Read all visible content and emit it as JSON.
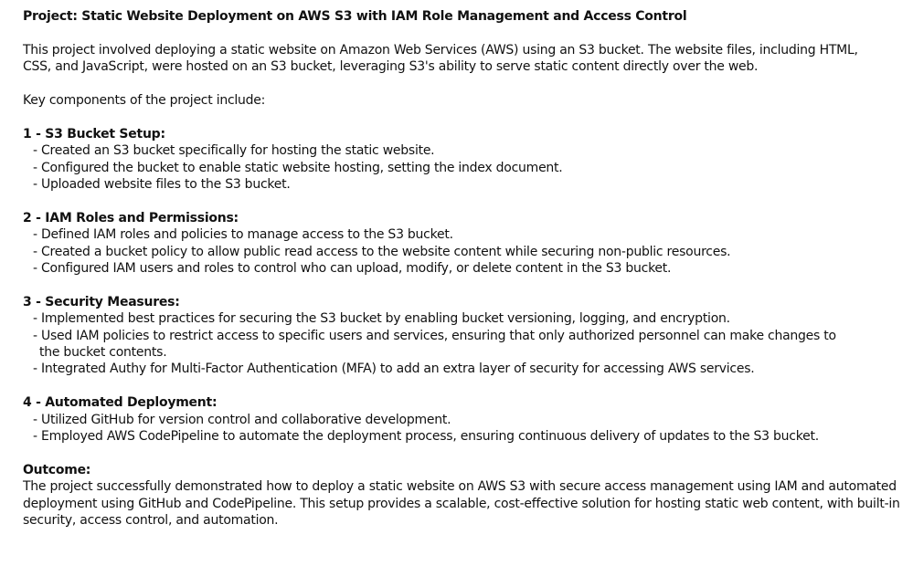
{
  "title": "Project: Static Website Deployment on AWS S3 with IAM Role Management and Access Control",
  "intro": [
    "This project involved deploying a static website on Amazon Web Services (AWS) using an S3 bucket. The website files, including HTML,",
    "CSS, and JavaScript, were hosted on an S3 bucket, leveraging S3's ability to serve static content directly over the web."
  ],
  "key_components_label": "Key components of the project include:",
  "sections": [
    {
      "heading": "1 - S3 Bucket Setup:",
      "items": [
        "- Created an S3 bucket specifically for hosting the static website.",
        "- Configured the bucket to enable static website hosting, setting the index document.",
        "- Uploaded website files to the S3 bucket."
      ]
    },
    {
      "heading": "2 - IAM Roles and Permissions:",
      "items": [
        "- Defined IAM roles and policies to manage access to the S3 bucket.",
        "- Created a bucket policy to allow public read access to the website content while securing non-public resources.",
        "- Configured IAM users and roles to control who can upload, modify, or delete content in the S3 bucket."
      ]
    },
    {
      "heading": "3 - Security Measures:",
      "items": [
        "- Implemented best practices for securing the S3 bucket by enabling bucket versioning, logging, and encryption.",
        "- Used IAM policies to restrict access to specific users and services, ensuring that only authorized personnel can make changes to",
        "the bucket contents.",
        "- Integrated Authy for Multi-Factor Authentication (MFA) to add an extra layer of security for accessing AWS services."
      ]
    },
    {
      "heading": "4 - Automated Deployment:",
      "items": [
        "- Utilized GitHub for version control and collaborative development.",
        "- Employed AWS CodePipeline to automate the deployment process, ensuring continuous delivery of updates to the S3 bucket."
      ]
    }
  ],
  "outcome": {
    "heading": "Outcome:",
    "lines": [
      "The project successfully demonstrated how to deploy a static website on AWS S3 with secure access management using IAM and automated",
      "deployment using GitHub and CodePipeline. This setup provides a scalable, cost-effective solution for hosting static web content, with built-in",
      "security, access control, and automation."
    ]
  }
}
